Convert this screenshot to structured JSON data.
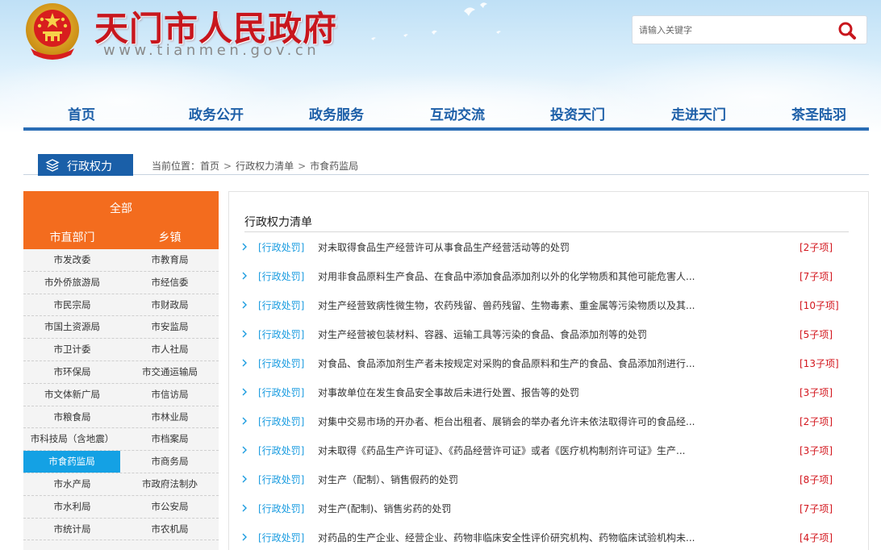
{
  "site": {
    "title": "天门市人民政府",
    "url": "www.tianmen.gov.cn"
  },
  "search": {
    "placeholder": "请输入关键字"
  },
  "nav": [
    {
      "label": "首页"
    },
    {
      "label": "政务公开"
    },
    {
      "label": "政务服务"
    },
    {
      "label": "互动交流"
    },
    {
      "label": "投资天门"
    },
    {
      "label": "走进天门"
    },
    {
      "label": "茶圣陆羽"
    }
  ],
  "section": {
    "tab_label": "行政权力",
    "breadcrumb_prefix": "当前位置：",
    "crumbs": [
      "首页",
      "行政权力清单",
      "市食药监局"
    ]
  },
  "sidebar": {
    "all_label": "全部",
    "tab_left": "市直部门",
    "tab_right": "乡镇",
    "rows": [
      {
        "left": "市发改委",
        "right": "市教育局"
      },
      {
        "left": "市外侨旅游局",
        "right": "市经信委"
      },
      {
        "left": "市民宗局",
        "right": "市财政局"
      },
      {
        "left": "市国土资源局",
        "right": "市安监局"
      },
      {
        "left": "市卫计委",
        "right": "市人社局"
      },
      {
        "left": "市环保局",
        "right": "市交通运输局"
      },
      {
        "left": "市文体新广局",
        "right": "市信访局"
      },
      {
        "left": "市粮食局",
        "right": "市林业局"
      },
      {
        "left": "市科技局（含地震）",
        "right": "市档案局"
      },
      {
        "left": "市食药监局",
        "right": "市商务局"
      },
      {
        "left": "市水产局",
        "right": "市政府法制办"
      },
      {
        "left": "市水利局",
        "right": "市公安局"
      },
      {
        "left": "市统计局",
        "right": "市农机局"
      }
    ],
    "active_index": 9
  },
  "main": {
    "title": "行政权力清单",
    "items": [
      {
        "category": "[行政处罚]",
        "text": "对未取得食品生产经营许可从事食品生产经营活动等的处罚",
        "count": "[2子项]"
      },
      {
        "category": "[行政处罚]",
        "text": "对用非食品原料生产食品、在食品中添加食品添加剂以外的化学物质和其他可能危害人...",
        "count": "[7子项]"
      },
      {
        "category": "[行政处罚]",
        "text": "对生产经营致病性微生物，农药残留、兽药残留、生物毒素、重金属等污染物质以及其...",
        "count": "[10子项]"
      },
      {
        "category": "[行政处罚]",
        "text": "对生产经营被包装材料、容器、运输工具等污染的食品、食品添加剂等的处罚",
        "count": "[5子项]"
      },
      {
        "category": "[行政处罚]",
        "text": "对食品、食品添加剂生产者未按规定对采购的食品原料和生产的食品、食品添加剂进行...",
        "count": "[13子项]"
      },
      {
        "category": "[行政处罚]",
        "text": "对事故单位在发生食品安全事故后未进行处置、报告等的处罚",
        "count": "[3子项]"
      },
      {
        "category": "[行政处罚]",
        "text": "对集中交易市场的开办者、柜台出租者、展销会的举办者允许未依法取得许可的食品经...",
        "count": "[2子项]"
      },
      {
        "category": "[行政处罚]",
        "text": "对未取得《药品生产许可证》、《药品经营许可证》或者《医疗机构制剂许可证》生产...",
        "count": "[3子项]"
      },
      {
        "category": "[行政处罚]",
        "text": "对生产（配制）、销售假药的处罚",
        "count": "[8子项]"
      },
      {
        "category": "[行政处罚]",
        "text": "对生产(配制)、销售劣药的处罚",
        "count": "[7子项]"
      },
      {
        "category": "[行政处罚]",
        "text": "对药品的生产企业、经营企业、药物非临床安全性评价研究机构、药物临床试验机构未...",
        "count": "[4子项]"
      }
    ]
  },
  "colors": {
    "brand_red": "#c8161d",
    "nav_blue": "#1d5fa8",
    "sidebar_orange": "#f36c1e",
    "active_cyan": "#14a1e4",
    "category_blue": "#1b9ce0",
    "count_red": "#d3161d"
  },
  "icons": {
    "emblem": "national-emblem-icon",
    "search": "search-icon",
    "section": "layers-icon",
    "list_marker": "chevron-right-icon"
  }
}
